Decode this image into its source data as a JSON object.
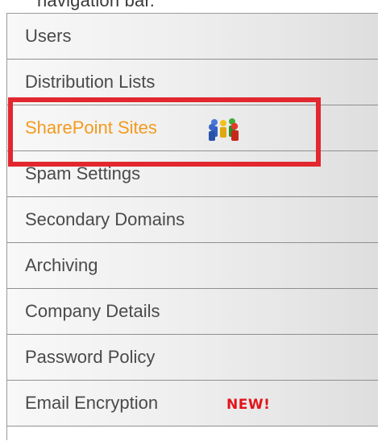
{
  "caption": "navigation bar.",
  "nav": {
    "items": [
      {
        "label": "Users"
      },
      {
        "label": "Distribution Lists"
      },
      {
        "label": "SharePoint Sites",
        "active": true,
        "icon": "people-group-icon"
      },
      {
        "label": "Spam Settings"
      },
      {
        "label": "Secondary Domains"
      },
      {
        "label": "Archiving"
      },
      {
        "label": "Company Details"
      },
      {
        "label": "Password Policy"
      },
      {
        "label": "Email Encryption",
        "badge": "NEW!"
      }
    ]
  },
  "colors": {
    "active_text": "#f39a1e",
    "default_text": "#4a4a4a",
    "highlight_border": "#e2272e",
    "badge": "#e2141b"
  }
}
